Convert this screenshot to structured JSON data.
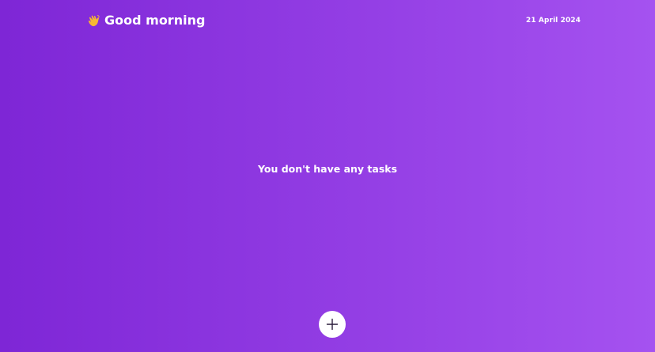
{
  "header": {
    "greeting": "Good morning",
    "greeting_icon": "waving-hand-icon",
    "date": "21 April 2024"
  },
  "main": {
    "empty_message": "You don't have any tasks"
  },
  "fab": {
    "icon": "plus-icon"
  },
  "colors": {
    "gradient_start": "#7e26d6",
    "gradient_end": "#a552f0",
    "text": "#ffffff",
    "button_bg": "#ffffff",
    "icon_dark": "#2b1d3a",
    "wave_hand": "#f7b733"
  }
}
